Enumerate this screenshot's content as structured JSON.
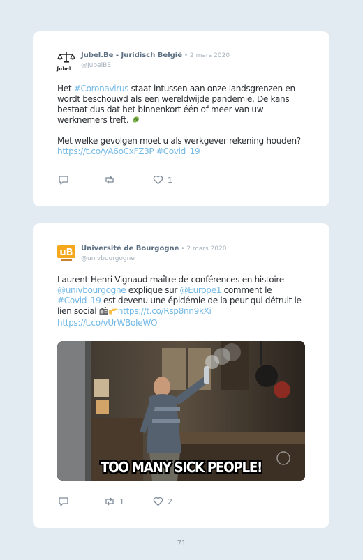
{
  "tweets": [
    {
      "author": "Jubel.Be - Juridisch België",
      "separator": " • ",
      "date": "2 mars 2020",
      "handle": "@JubelBE",
      "avatar_text": "Jubel",
      "avatar_icon": "scales-of-justice-icon",
      "para1": {
        "pre": "Het ",
        "hashtag": "#Coronavirus",
        "post": " staat intussen aan onze landsgrenzen en wordt beschouwd als een wereldwijde pandemie. De kans bestaat dus dat het binnenkort één of meer van uw werknemers treft. ",
        "emoji": "microbe-icon"
      },
      "para2": {
        "pre": "Met welke gevolgen moet u als werkgever rekening houden? ",
        "link": "https://t.co/yA6oCxFZ3P",
        "hashtag": " #Covid_19"
      },
      "replies": "",
      "retweets": "",
      "likes": "1"
    },
    {
      "author": "Université de Bourgogne",
      "separator": " • ",
      "date": "2 mars 2020",
      "handle": "@univbourgogne",
      "avatar_text": "uB",
      "avatar_icon": "ub-logo-icon",
      "text": {
        "part1": "Laurent-Henri Vignaud maître de conférences en histoire ",
        "mention1": "@univbourgogne",
        "part2": " explique sur ",
        "mention2": "@Europe1",
        "part3": " comment le ",
        "hashtag": "#Covid_19",
        "part4": " est devenu une épidémie de la peur qui détruit le lien social ",
        "emoji1": "radio-icon",
        "emoji2": "pointing-hand-icon",
        "link1": "https://t.co/Rsp8nn9kXi",
        "link2": "https://t.co/vUrWBoIeWO"
      },
      "media_caption": "TOO MANY SICK PEOPLE!",
      "replies": "",
      "retweets": "1",
      "likes": "2"
    }
  ],
  "page_number": "71",
  "colors": {
    "background": "#e3ebf2",
    "card": "#ffffff",
    "link": "#73b9e6",
    "name": "#5b6f82",
    "muted": "#a7b2bd"
  }
}
